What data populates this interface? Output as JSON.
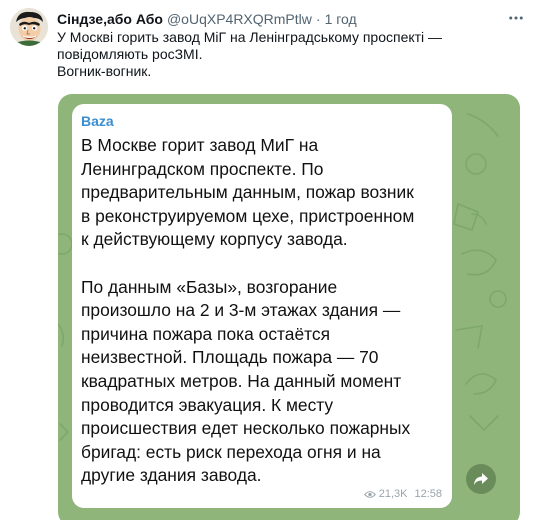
{
  "tweet": {
    "author_name": "Сіндзе,або Або",
    "handle": "@oUqXP4RXQRmPtlw",
    "separator": "·",
    "time": "1 год",
    "text_lines": [
      "У Москві горить завод МіГ на Ленінградському проспекті —",
      "повідомляють росЗМІ.",
      "Вогник-вогник."
    ]
  },
  "media": {
    "channel": "Baza",
    "message_lines": [
      "В Москве горит завод МиГ на",
      "Ленинградском проспекте. По",
      "предварительным данным, пожар возник",
      "в реконструируемом цехе, пристроенном",
      "к действующему корпусу завода.",
      "",
      "По данным «Базы», возгорание",
      "произошло на 2 и 3-м этажах здания —",
      "причина пожара пока остаётся",
      "неизвестной. Площадь пожара — 70",
      "квадратных метров. На данный момент",
      "проводится эвакуация. К месту",
      "происшествия едет несколько пожарных",
      "бригад: есть риск перехода огня и на",
      "другие здания завода."
    ],
    "views": "21,3K",
    "timestamp": "12:58",
    "colors": {
      "background": "#8fb57a",
      "channel_name": "#3a8ed0"
    }
  },
  "icons": {
    "more": "more-icon",
    "views": "eye-icon",
    "share": "share-icon"
  }
}
